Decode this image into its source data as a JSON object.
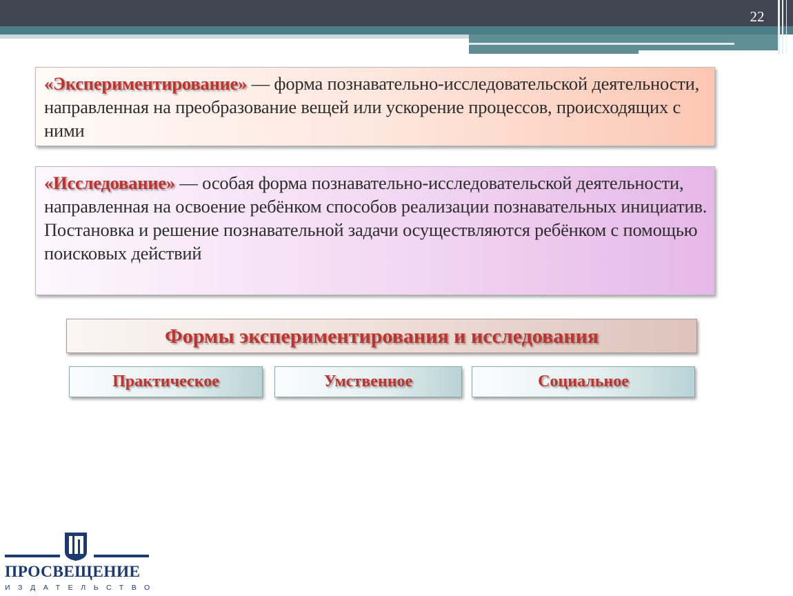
{
  "slide": {
    "number": "22"
  },
  "definitions": [
    {
      "term": "«Экспериментирование»",
      "text": " — форма познавательно-исследовательской деятельности, направленная на преобразование вещей или ускорение процессов, происходящих с ними"
    },
    {
      "term": "«Исследование»",
      "text": " — особая форма познавательно-исследовательской деятельности, направленная на освоение ребёнком способов реализации познавательных инициатив. Постановка и решение познавательной задачи осуществляются ребёнком с помощью поисковых действий"
    }
  ],
  "forms": {
    "title": "Формы экспериментирования и исследования",
    "items": [
      "Практическое",
      "Умственное",
      "Социальное"
    ]
  },
  "logo": {
    "name": "ПРОСВЕЩЕНИЕ",
    "subtitle": "ИЗДАТЕЛЬСТВО",
    "icon": "prosveshchenie-emblem-icon"
  },
  "colors": {
    "header_dark": "#414451",
    "header_teal": "#4b7e86",
    "term_red": "#c0322e",
    "logo_blue": "#1c3a72"
  }
}
